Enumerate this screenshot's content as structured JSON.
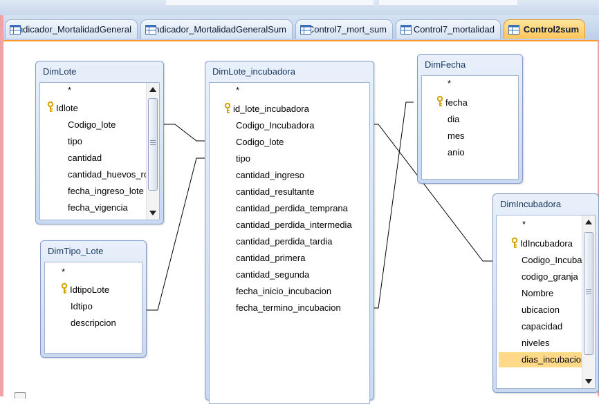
{
  "tabs": [
    {
      "label": "Indicador_MortalidadGeneral",
      "active": false
    },
    {
      "label": "Indicador_MortalidadGeneralSum",
      "active": false
    },
    {
      "label": "Control7_mort_sum",
      "active": false
    },
    {
      "label": "Control7_mortalidad",
      "active": false
    },
    {
      "label": "Control2sum",
      "active": true
    }
  ],
  "tables": {
    "dimlote": {
      "title": "DimLote",
      "fields": [
        "*",
        "Idlote",
        "Codigo_lote",
        "tipo",
        "cantidad",
        "cantidad_huevos_roto",
        "fecha_ingreso_lote",
        "fecha_vigencia"
      ]
    },
    "dimtipo": {
      "title": "DimTipo_Lote",
      "fields": [
        "*",
        "IdtipoLote",
        "Idtipo",
        "descripcion"
      ]
    },
    "incub": {
      "title": "DimLote_incubadora",
      "fields": [
        "*",
        "id_lote_incubadora",
        "Codigo_Incubadora",
        "Codigo_lote",
        "tipo",
        "cantidad_ingreso",
        "cantidad_resultante",
        "cantidad_perdida_temprana",
        "cantidad_perdida_intermedia",
        "cantidad_perdida_tardia",
        "cantidad_primera",
        "cantidad_segunda",
        "fecha_inicio_incubacion",
        "fecha_termino_incubacion"
      ]
    },
    "fecha": {
      "title": "DimFecha",
      "fields": [
        "*",
        "fecha",
        "dia",
        "mes",
        "anio"
      ]
    },
    "incubadora": {
      "title": "DimIncubadora",
      "fields": [
        "*",
        "IdIncubadora",
        "Codigo_Incubad",
        "codigo_granja",
        "Nombre",
        "ubicacion",
        "capacidad",
        "niveles",
        "dias_incubacion"
      ]
    }
  },
  "colors": {
    "accent": "#ff9a2e",
    "title_text": "#17365d",
    "key": "#d6a400",
    "selected_field": "#ffd98a"
  }
}
